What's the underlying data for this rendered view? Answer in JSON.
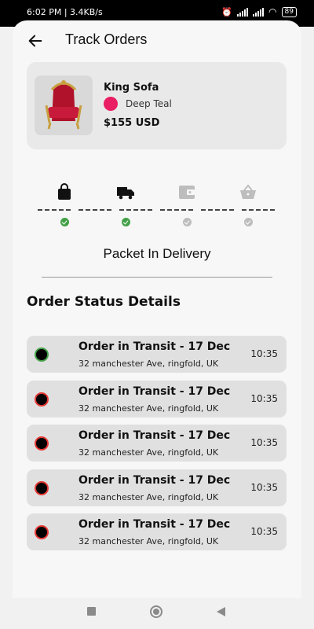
{
  "status_bar": {
    "time_speed": "6:02 PM | 3.4KB/s",
    "battery": "89"
  },
  "header": {
    "title": "Track Orders",
    "back_icon": "arrow-left-icon"
  },
  "product": {
    "name": "King Sofa",
    "color_name": "Deep Teal",
    "color_swatch": "#e91e63",
    "price": "$155 USD",
    "image_icon": "red-throne-chair"
  },
  "tracker": {
    "steps": [
      {
        "icon": "shopping-bag-icon",
        "done": true
      },
      {
        "icon": "delivery-truck-icon",
        "done": true
      },
      {
        "icon": "wallet-icon",
        "done": false
      },
      {
        "icon": "basket-icon",
        "done": false
      }
    ],
    "current_label": "Packet In Delivery",
    "done_color": "#43a047",
    "pending_color": "#bdbdbd"
  },
  "details": {
    "title": "Order Status Details",
    "items": [
      {
        "title": "Order in Transit - 17 Dec",
        "address": "32 manchester Ave, ringfold, UK",
        "time": "10:35",
        "active": true
      },
      {
        "title": "Order in Transit - 17 Dec",
        "address": "32 manchester Ave, ringfold, UK",
        "time": "10:35",
        "active": false
      },
      {
        "title": "Order in Transit - 17 Dec",
        "address": "32 manchester Ave, ringfold, UK",
        "time": "10:35",
        "active": false
      },
      {
        "title": "Order in Transit - 17 Dec",
        "address": "32 manchester Ave, ringfold, UK",
        "time": "10:35",
        "active": false
      },
      {
        "title": "Order in Transit - 17 Dec",
        "address": "32 manchester Ave, ringfold, UK",
        "time": "10:35",
        "active": false
      }
    ]
  },
  "navbar": {
    "icons": [
      "recents-square-icon",
      "home-circle-icon",
      "back-triangle-icon"
    ]
  }
}
